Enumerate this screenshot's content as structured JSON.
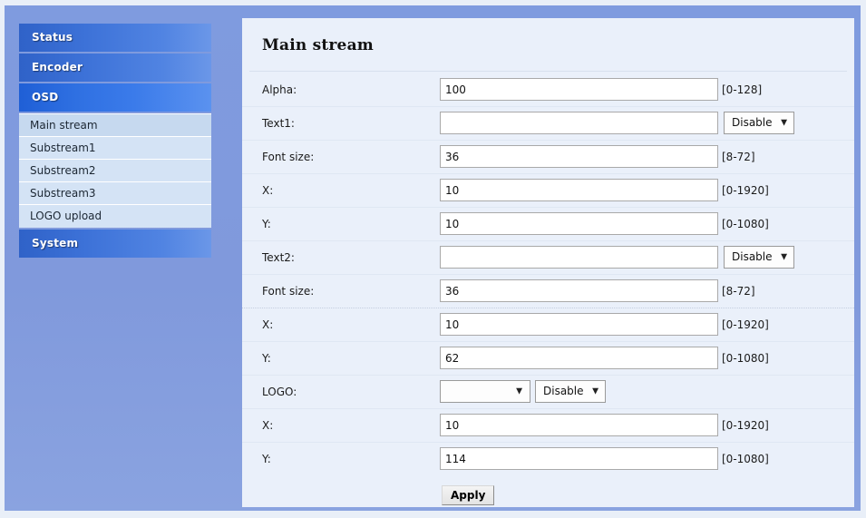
{
  "sidebar": {
    "groups": [
      {
        "label": "Status",
        "active": false
      },
      {
        "label": "Encoder",
        "active": false
      },
      {
        "label": "OSD",
        "active": true
      }
    ],
    "sub_items": [
      {
        "label": "Main stream",
        "selected": true
      },
      {
        "label": "Substream1",
        "selected": false
      },
      {
        "label": "Substream2",
        "selected": false
      },
      {
        "label": "Substream3",
        "selected": false
      },
      {
        "label": "LOGO upload",
        "selected": false
      }
    ],
    "system": {
      "label": "System",
      "active": false
    }
  },
  "content": {
    "title": "Main stream",
    "rows": [
      {
        "label": "Alpha:",
        "value": "100",
        "hint": "[0-128]"
      },
      {
        "label": "Text1:",
        "value": "",
        "select": "Disable"
      },
      {
        "label": "Font size:",
        "value": "36",
        "hint": "[8-72]"
      },
      {
        "label": "X:",
        "value": "10",
        "hint": "[0-1920]"
      },
      {
        "label": "Y:",
        "value": "10",
        "hint": "[0-1080]"
      },
      {
        "label": "Text2:",
        "value": "",
        "select": "Disable"
      },
      {
        "label": "Font size:",
        "value": "36",
        "hint": "[8-72]"
      },
      {
        "label": "X:",
        "value": "10",
        "hint": "[0-1920]"
      },
      {
        "label": "Y:",
        "value": "62",
        "hint": "[0-1080]"
      },
      {
        "label": "LOGO:",
        "logo_select": "",
        "select": "Disable"
      },
      {
        "label": "X:",
        "value": "10",
        "hint": "[0-1920]"
      },
      {
        "label": "Y:",
        "value": "114",
        "hint": "[0-1080]"
      }
    ],
    "apply_label": "Apply"
  },
  "colors": {
    "page_background": "#e9eff8",
    "body_panel": "#7f9bdf",
    "nav_header": "#3d72d8",
    "nav_header_active": "#2f70e2",
    "nav_sub": "#d4e3f5",
    "nav_sub_selected": "#c6d9ef",
    "content_panel": "#eaf0fa",
    "input_border": "#a9a9a9"
  },
  "icons": {
    "dropdown_arrow": "▼"
  }
}
